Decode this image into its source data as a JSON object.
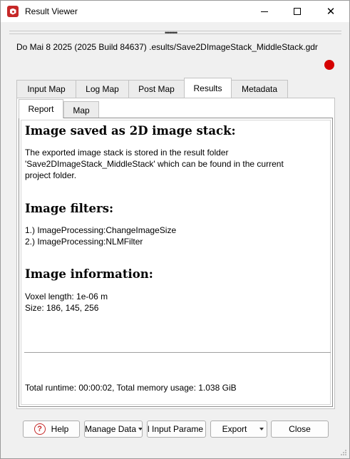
{
  "window": {
    "title": "Result Viewer",
    "minimize_glyph": "",
    "close_glyph": "✕"
  },
  "header": {
    "path": "Do Mai 8 2025 (2025 Build 84637) .esults/Save2DImageStack_MiddleStack.gdr",
    "status_color": "#d50000",
    "grip": "••••••••"
  },
  "tabs": {
    "input_map": "Input Map",
    "log_map": "Log Map",
    "post_map": "Post Map",
    "results": "Results",
    "metadata": "Metadata",
    "active": "Results"
  },
  "subtabs": {
    "report": "Report",
    "map": "Map",
    "active": "Report"
  },
  "report": {
    "saved_heading": "Image saved as 2D image stack:",
    "saved_line1": "The exported image stack is stored in the result folder",
    "saved_line2": "'Save2DImageStack_MiddleStack' which can be found in the current",
    "saved_line3": "project folder.",
    "filters_heading": "Image filters:",
    "filter1": "1.) ImageProcessing:ChangeImageSize",
    "filter2": "2.) ImageProcessing:NLMFilter",
    "info_heading": "Image information:",
    "voxel_length": "Voxel length: 1e-06 m",
    "size": "Size: 186, 145, 256",
    "runtime": "Total runtime: 00:00:02, Total memory usage: 1.038 GiB"
  },
  "buttons": {
    "help": "Help",
    "help_icon": "?",
    "manage_data": "Manage Data",
    "input_params": "l Input Parame",
    "export": "Export",
    "close": "Close"
  },
  "colors": {
    "accent": "#c62828"
  }
}
